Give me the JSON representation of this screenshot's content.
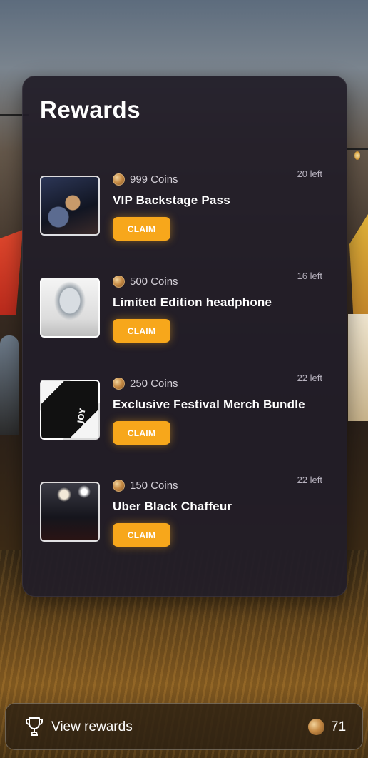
{
  "panel": {
    "title": "Rewards"
  },
  "rewards": [
    {
      "coins": "999 Coins",
      "name": "VIP Backstage Pass",
      "left": "20 left",
      "claim_label": "CLAIM",
      "image": "backstage-photo"
    },
    {
      "coins": "500 Coins",
      "name": "Limited Edition headphone",
      "left": "16 left",
      "claim_label": "CLAIM",
      "image": "headphone-photo"
    },
    {
      "coins": "250 Coins",
      "name": "Exclusive Festival Merch Bundle",
      "left": "22 left",
      "claim_label": "CLAIM",
      "image": "merch-photo",
      "image_text": "JOY"
    },
    {
      "coins": "150 Coins",
      "name": "Uber Black Chaffeur",
      "left": "22 left",
      "claim_label": "CLAIM",
      "image": "chauffeur-photo"
    }
  ],
  "bottom_bar": {
    "label": "View rewards",
    "balance": "71",
    "icon": "trophy-icon"
  },
  "colors": {
    "accent": "#f7a71b",
    "panel": "#211d28"
  }
}
